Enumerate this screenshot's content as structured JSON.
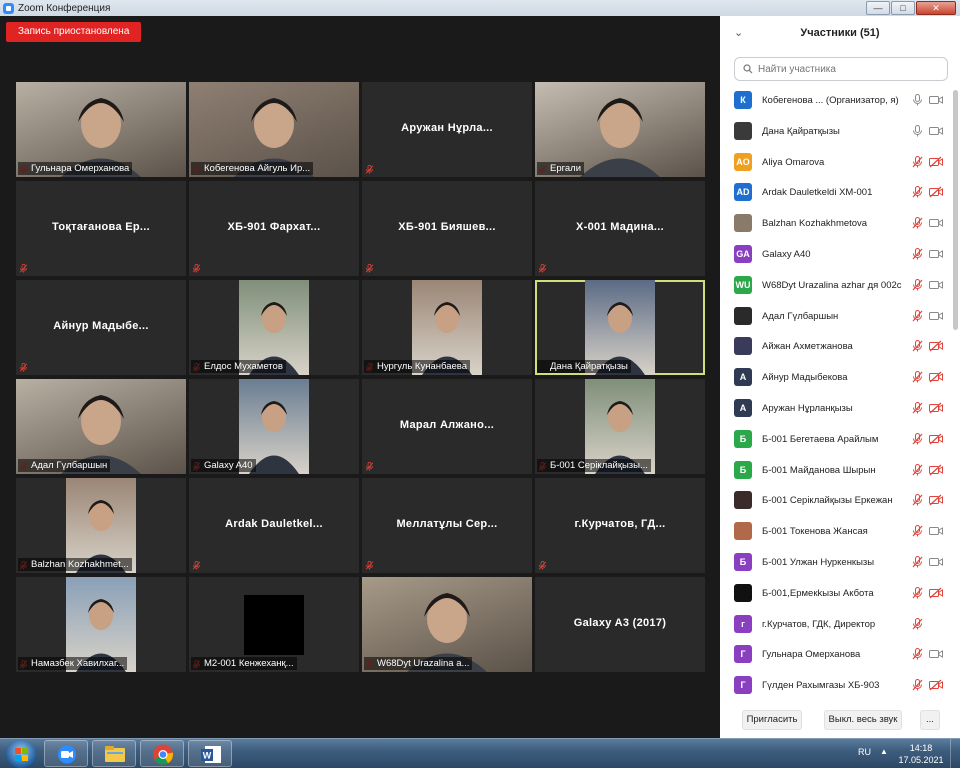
{
  "window": {
    "title": "Zoom Конференция",
    "min_glyph": "—",
    "max_glyph": "□",
    "close_glyph": "✕"
  },
  "recording_badge": "Запись приостановлена",
  "grid": [
    {
      "caption": "Гульнара Омерханова",
      "big": "",
      "video": "photo",
      "muted": true,
      "speaking": false
    },
    {
      "caption": "Кобегенова Айгуль Ир...",
      "big": "",
      "video": "photo",
      "muted": true,
      "speaking": false
    },
    {
      "caption": "",
      "big": "Аружан Нұрла...",
      "video": "none",
      "muted": true,
      "speaking": false
    },
    {
      "caption": "Ергали",
      "big": "",
      "video": "photo",
      "muted": true,
      "speaking": false
    },
    {
      "caption": "",
      "big": "Тоқтағанова Ер...",
      "video": "none",
      "muted": true,
      "speaking": false
    },
    {
      "caption": "",
      "big": "ХБ-901 Фархат...",
      "video": "none",
      "muted": true,
      "speaking": false
    },
    {
      "caption": "",
      "big": "ХБ-901 Бияшев...",
      "video": "none",
      "muted": true,
      "speaking": false
    },
    {
      "caption": "",
      "big": "Х-001 Мадина...",
      "video": "none",
      "muted": true,
      "speaking": false
    },
    {
      "caption": "",
      "big": "Айнур Мадыбе...",
      "video": "none",
      "muted": true,
      "speaking": false
    },
    {
      "caption": "Елдос Мухаметов",
      "big": "",
      "video": "portrait",
      "muted": true,
      "speaking": false
    },
    {
      "caption": "Нургуль Кунанбаева",
      "big": "",
      "video": "portrait",
      "muted": true,
      "speaking": false
    },
    {
      "caption": "Дана Қайратқызы",
      "big": "",
      "video": "portrait",
      "muted": false,
      "speaking": true
    },
    {
      "caption": "Адал Гүлбаршын",
      "big": "",
      "video": "photo",
      "muted": true,
      "speaking": false
    },
    {
      "caption": "Galaxy A40",
      "big": "",
      "video": "portrait",
      "muted": true,
      "speaking": false
    },
    {
      "caption": "",
      "big": "Марал Алжано...",
      "video": "none",
      "muted": true,
      "speaking": false
    },
    {
      "caption": "Б-001 Серіклайқызы...",
      "big": "",
      "video": "portrait",
      "muted": true,
      "speaking": false
    },
    {
      "caption": "Balzhan Kozhakhmet...",
      "big": "",
      "video": "portrait",
      "muted": true,
      "speaking": false
    },
    {
      "caption": "",
      "big": "Ardak Dauletkel...",
      "video": "none",
      "muted": true,
      "speaking": false
    },
    {
      "caption": "",
      "big": "Меллатұлы Сер...",
      "video": "none",
      "muted": true,
      "speaking": false
    },
    {
      "caption": "",
      "big": "г.Курчатов, ГД...",
      "video": "none",
      "muted": true,
      "speaking": false
    },
    {
      "caption": "Намазбек Хавилхаг...",
      "big": "",
      "video": "portrait",
      "muted": true,
      "speaking": false
    },
    {
      "caption": "М2-001 Кенжеханқ...",
      "big": "",
      "video": "black",
      "muted": true,
      "speaking": false
    },
    {
      "caption": "W68Dyt Urazalina a...",
      "big": "",
      "video": "photo",
      "muted": true,
      "speaking": false
    },
    {
      "caption": "",
      "big": "Galaxy A3 (2017)",
      "video": "none",
      "muted": false,
      "speaking": false
    }
  ],
  "sidebar": {
    "collapse_glyph": "⌄",
    "title": "Участники (51)",
    "search_placeholder": "Найти участника",
    "participants": [
      {
        "initials": "К",
        "color": "#1f6fd1",
        "name": "Кобегенова ...  (Организатор, я)",
        "mic": "on",
        "cam": "off"
      },
      {
        "initials": "",
        "color": "#3a3a3a",
        "name": "Дана Қайратқызы",
        "mic": "on",
        "cam": "off"
      },
      {
        "initials": "AO",
        "color": "#f0a020",
        "name": "Aliya Omarova",
        "mic": "muted",
        "cam": "muted"
      },
      {
        "initials": "AD",
        "color": "#1f6fd1",
        "name": "Ardak Dauletkeldi  ХМ-001",
        "mic": "muted",
        "cam": "muted"
      },
      {
        "initials": "",
        "color": "#8a7a6a",
        "name": "Balzhan Kozhakhmetova",
        "mic": "muted",
        "cam": "off"
      },
      {
        "initials": "GA",
        "color": "#8a3fc0",
        "name": "Galaxy A40",
        "mic": "muted",
        "cam": "off"
      },
      {
        "initials": "WU",
        "color": "#2aa84a",
        "name": "W68Dyt  Urazalina azhar дя 002с",
        "mic": "muted",
        "cam": "off"
      },
      {
        "initials": "",
        "color": "#2a2a2a",
        "name": "Адал Гүлбаршын",
        "mic": "muted",
        "cam": "off"
      },
      {
        "initials": "",
        "color": "#3a3a5a",
        "name": "Айжан Ахметжанова",
        "mic": "muted",
        "cam": "muted"
      },
      {
        "initials": "А",
        "color": "#2f3b52",
        "name": "Айнур Мадыбекова",
        "mic": "muted",
        "cam": "muted"
      },
      {
        "initials": "А",
        "color": "#2f3b52",
        "name": "Аружан Нұрланқызы",
        "mic": "muted",
        "cam": "muted"
      },
      {
        "initials": "Б",
        "color": "#2aa84a",
        "name": "Б-001 Бегетаева Арайлым",
        "mic": "muted",
        "cam": "muted"
      },
      {
        "initials": "Б",
        "color": "#2aa84a",
        "name": "Б-001 Майданова Шырын",
        "mic": "muted",
        "cam": "muted"
      },
      {
        "initials": "",
        "color": "#3a2a2a",
        "name": "Б-001 Серіклайқызы Еркежан",
        "mic": "muted",
        "cam": "muted"
      },
      {
        "initials": "",
        "color": "#b06a4a",
        "name": "Б-001 Токенова Жансая",
        "mic": "muted",
        "cam": "off"
      },
      {
        "initials": "Б",
        "color": "#8a3fc0",
        "name": "Б-001 Улжан Нуркенкызы",
        "mic": "muted",
        "cam": "off"
      },
      {
        "initials": "",
        "color": "#111111",
        "name": "Б-001,Ермекkызы Акбота",
        "mic": "muted",
        "cam": "muted"
      },
      {
        "initials": "г",
        "color": "#8a3fc0",
        "name": "г.Курчатов, ГДК, Директор",
        "mic": "muted",
        "cam": "none"
      },
      {
        "initials": "Г",
        "color": "#8a3fc0",
        "name": "Гульнара Омерханова",
        "mic": "muted",
        "cam": "off"
      },
      {
        "initials": "Г",
        "color": "#8a3fc0",
        "name": "Гүлден Рахымгазы ХБ-903",
        "mic": "muted",
        "cam": "muted"
      }
    ],
    "footer": {
      "invite": "Пригласить",
      "mute_all": "Выкл. весь звук",
      "more": "..."
    }
  },
  "taskbar": {
    "lang": "RU",
    "tray_arrow": "▲",
    "time": "14:18",
    "date": "17.05.2021"
  }
}
